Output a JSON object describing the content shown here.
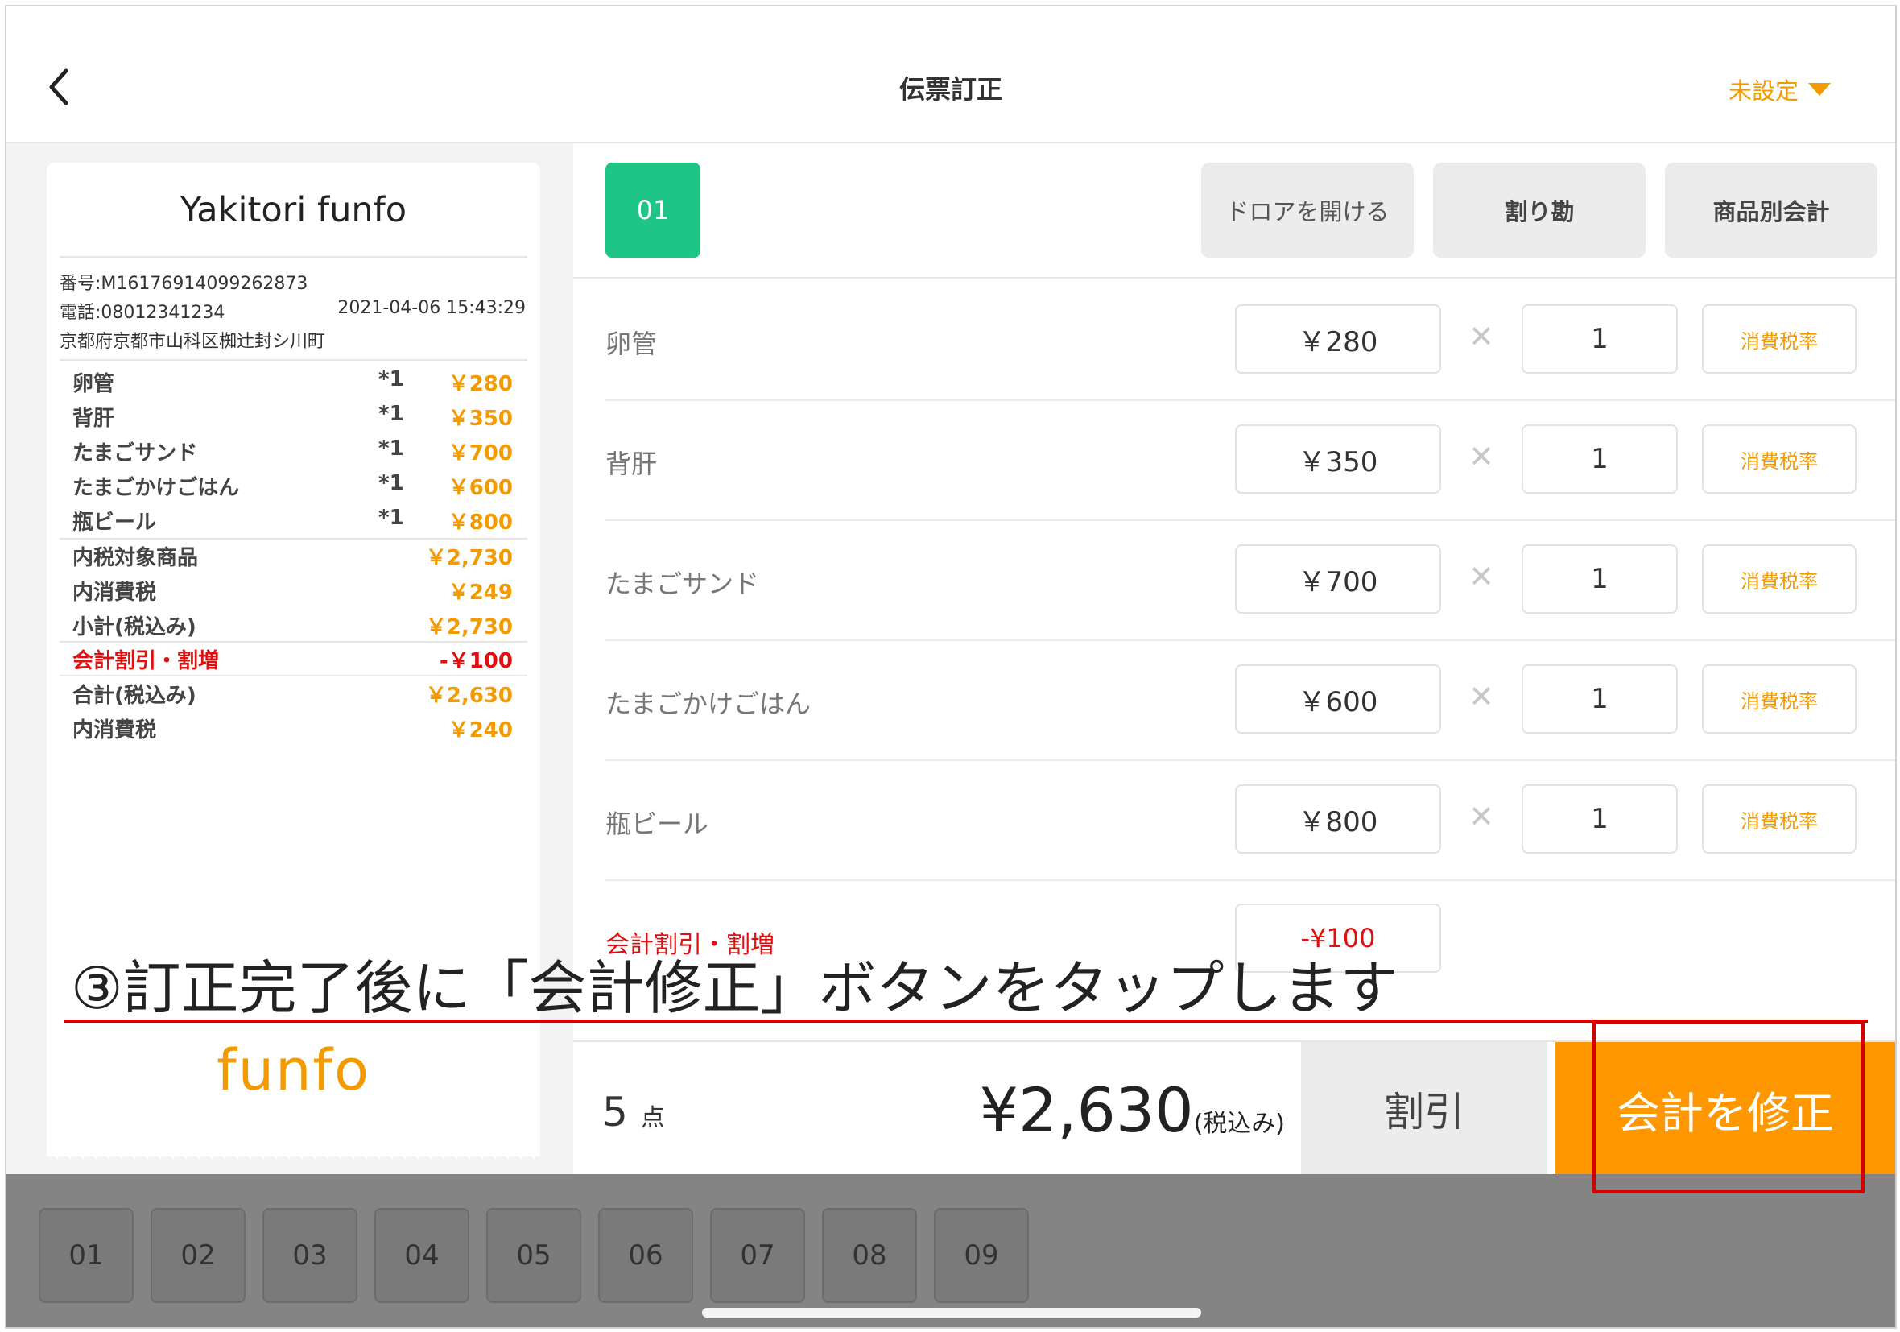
{
  "header": {
    "title": "伝票訂正",
    "staff_select": "未設定"
  },
  "receipt": {
    "shop_name": "Yakitori funfo",
    "number": "番号:M16176914099262873",
    "phone": "電話:08012341234",
    "datetime": "2021-04-06 15:43:29",
    "address": "京都府京都市山科区椥辻封シ川町",
    "items": [
      {
        "name": "卵管",
        "qty": "*1",
        "price": "￥280"
      },
      {
        "name": "背肝",
        "qty": "*1",
        "price": "￥350"
      },
      {
        "name": "たまごサンド",
        "qty": "*1",
        "price": "￥700"
      },
      {
        "name": "たまごかけごはん",
        "qty": "*1",
        "price": "￥600"
      },
      {
        "name": "瓶ビール",
        "qty": "*1",
        "price": "￥800"
      }
    ],
    "tax_target_label": "内税対象商品",
    "tax_target_value": "￥2,730",
    "inner_tax_label": "内消費税",
    "inner_tax_value": "￥249",
    "subtotal_label": "小計(税込み)",
    "subtotal_value": "￥2,730",
    "discount_label": "会計割引・割増",
    "discount_value": "-￥100",
    "total_label": "合計(税込み)",
    "total_value": "￥2,630",
    "inner_tax2_label": "内消費税",
    "inner_tax2_value": "￥240",
    "logo_text": "funfo"
  },
  "panel": {
    "seat": "01",
    "actions": {
      "open_drawer": "ドロアを開ける",
      "split": "割り勘",
      "by_item": "商品別会計"
    },
    "times_symbol": "✕",
    "items": [
      {
        "name": "卵管",
        "price": "￥280",
        "qty": "1",
        "tax_label": "消費税率"
      },
      {
        "name": "背肝",
        "price": "￥350",
        "qty": "1",
        "tax_label": "消費税率"
      },
      {
        "name": "たまごサンド",
        "price": "￥700",
        "qty": "1",
        "tax_label": "消費税率"
      },
      {
        "name": "たまごかけごはん",
        "price": "￥600",
        "qty": "1",
        "tax_label": "消費税率"
      },
      {
        "name": "瓶ビール",
        "price": "￥800",
        "qty": "1",
        "tax_label": "消費税率"
      }
    ],
    "discount_name": "会計割引・割増",
    "discount_value": "-¥100"
  },
  "bottom": {
    "count": "5",
    "count_unit": "点",
    "total": "¥2,630",
    "total_suffix": "(税込み)",
    "discount_button": "割引",
    "settle_button": "会計を修正"
  },
  "seat_tabs": [
    "01",
    "02",
    "03",
    "04",
    "05",
    "06",
    "07",
    "08",
    "09"
  ],
  "annotation": "③訂正完了後に「会計修正」ボタンをタップします",
  "colors": {
    "accent": "#ff9800",
    "seat_green": "#1fc487",
    "discount_red": "#e01010",
    "annotation_red": "#d40000"
  }
}
